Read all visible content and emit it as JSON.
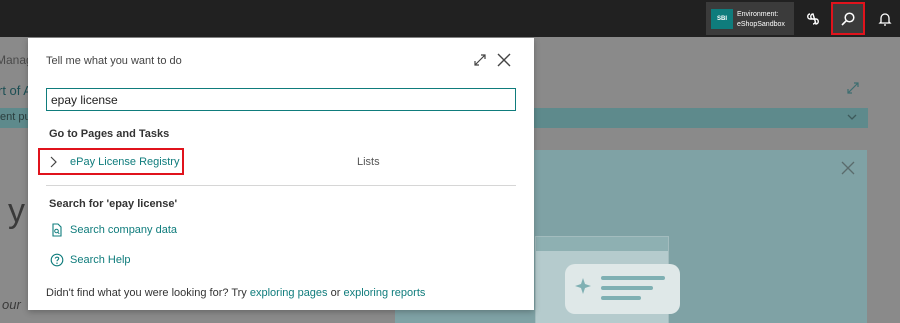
{
  "topbar": {
    "environment": {
      "badge": "SBI",
      "label": "Environment:",
      "name": "eShopSandbox"
    },
    "icons": [
      "copilot-icon",
      "search-icon",
      "bell-icon"
    ]
  },
  "background": {
    "text1": "Manag",
    "text2": "rt of A",
    "strip_text": "ent pu",
    "big_letter": "y",
    "italic_text": "our",
    "colors": {
      "accent": "#0f7c7c"
    }
  },
  "dialog": {
    "title": "Tell me what you want to do",
    "search": {
      "value": "epay license",
      "placeholder": ""
    },
    "go_to_heading": "Go to Pages and Tasks",
    "results": [
      {
        "label": "ePay License Registry",
        "category": "Lists"
      }
    ],
    "search_for_heading": "Search for 'epay license'",
    "links": {
      "company_data": "Search company data",
      "help": "Search Help"
    },
    "footer": {
      "prefix": "Didn't find what you were looking for? Try ",
      "link1": "exploring pages",
      "middle": " or ",
      "link2": "exploring reports"
    }
  }
}
